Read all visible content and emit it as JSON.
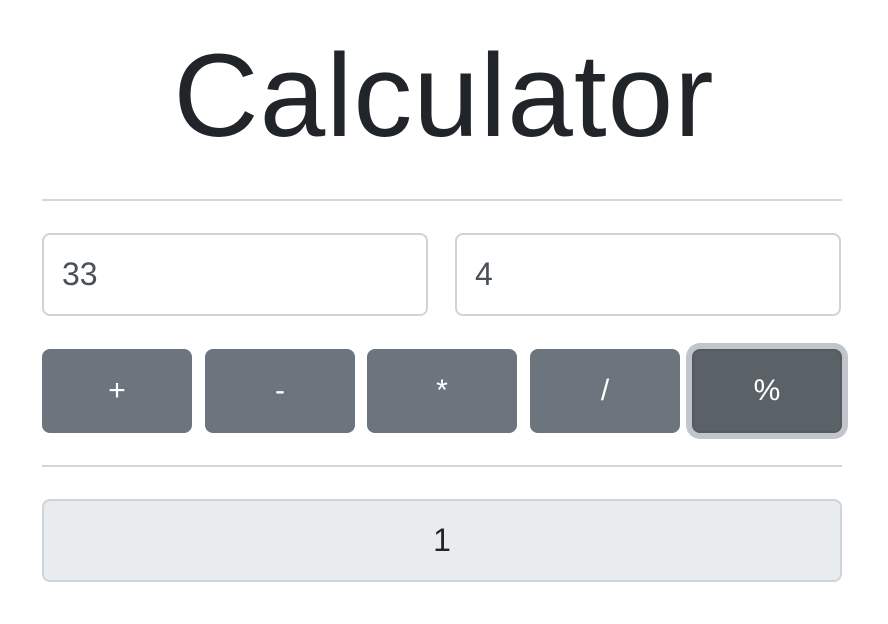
{
  "header": {
    "title": "Calculator"
  },
  "inputs": {
    "first_value": "33",
    "second_value": "4"
  },
  "operators": {
    "add": "+",
    "subtract": "-",
    "multiply": "*",
    "divide": "/",
    "modulo": "%"
  },
  "result": {
    "value": "1"
  },
  "colors": {
    "button_bg": "#6c757d",
    "active_button_bg": "#5a6268",
    "result_bg": "#e9ecef",
    "text": "#212529"
  }
}
